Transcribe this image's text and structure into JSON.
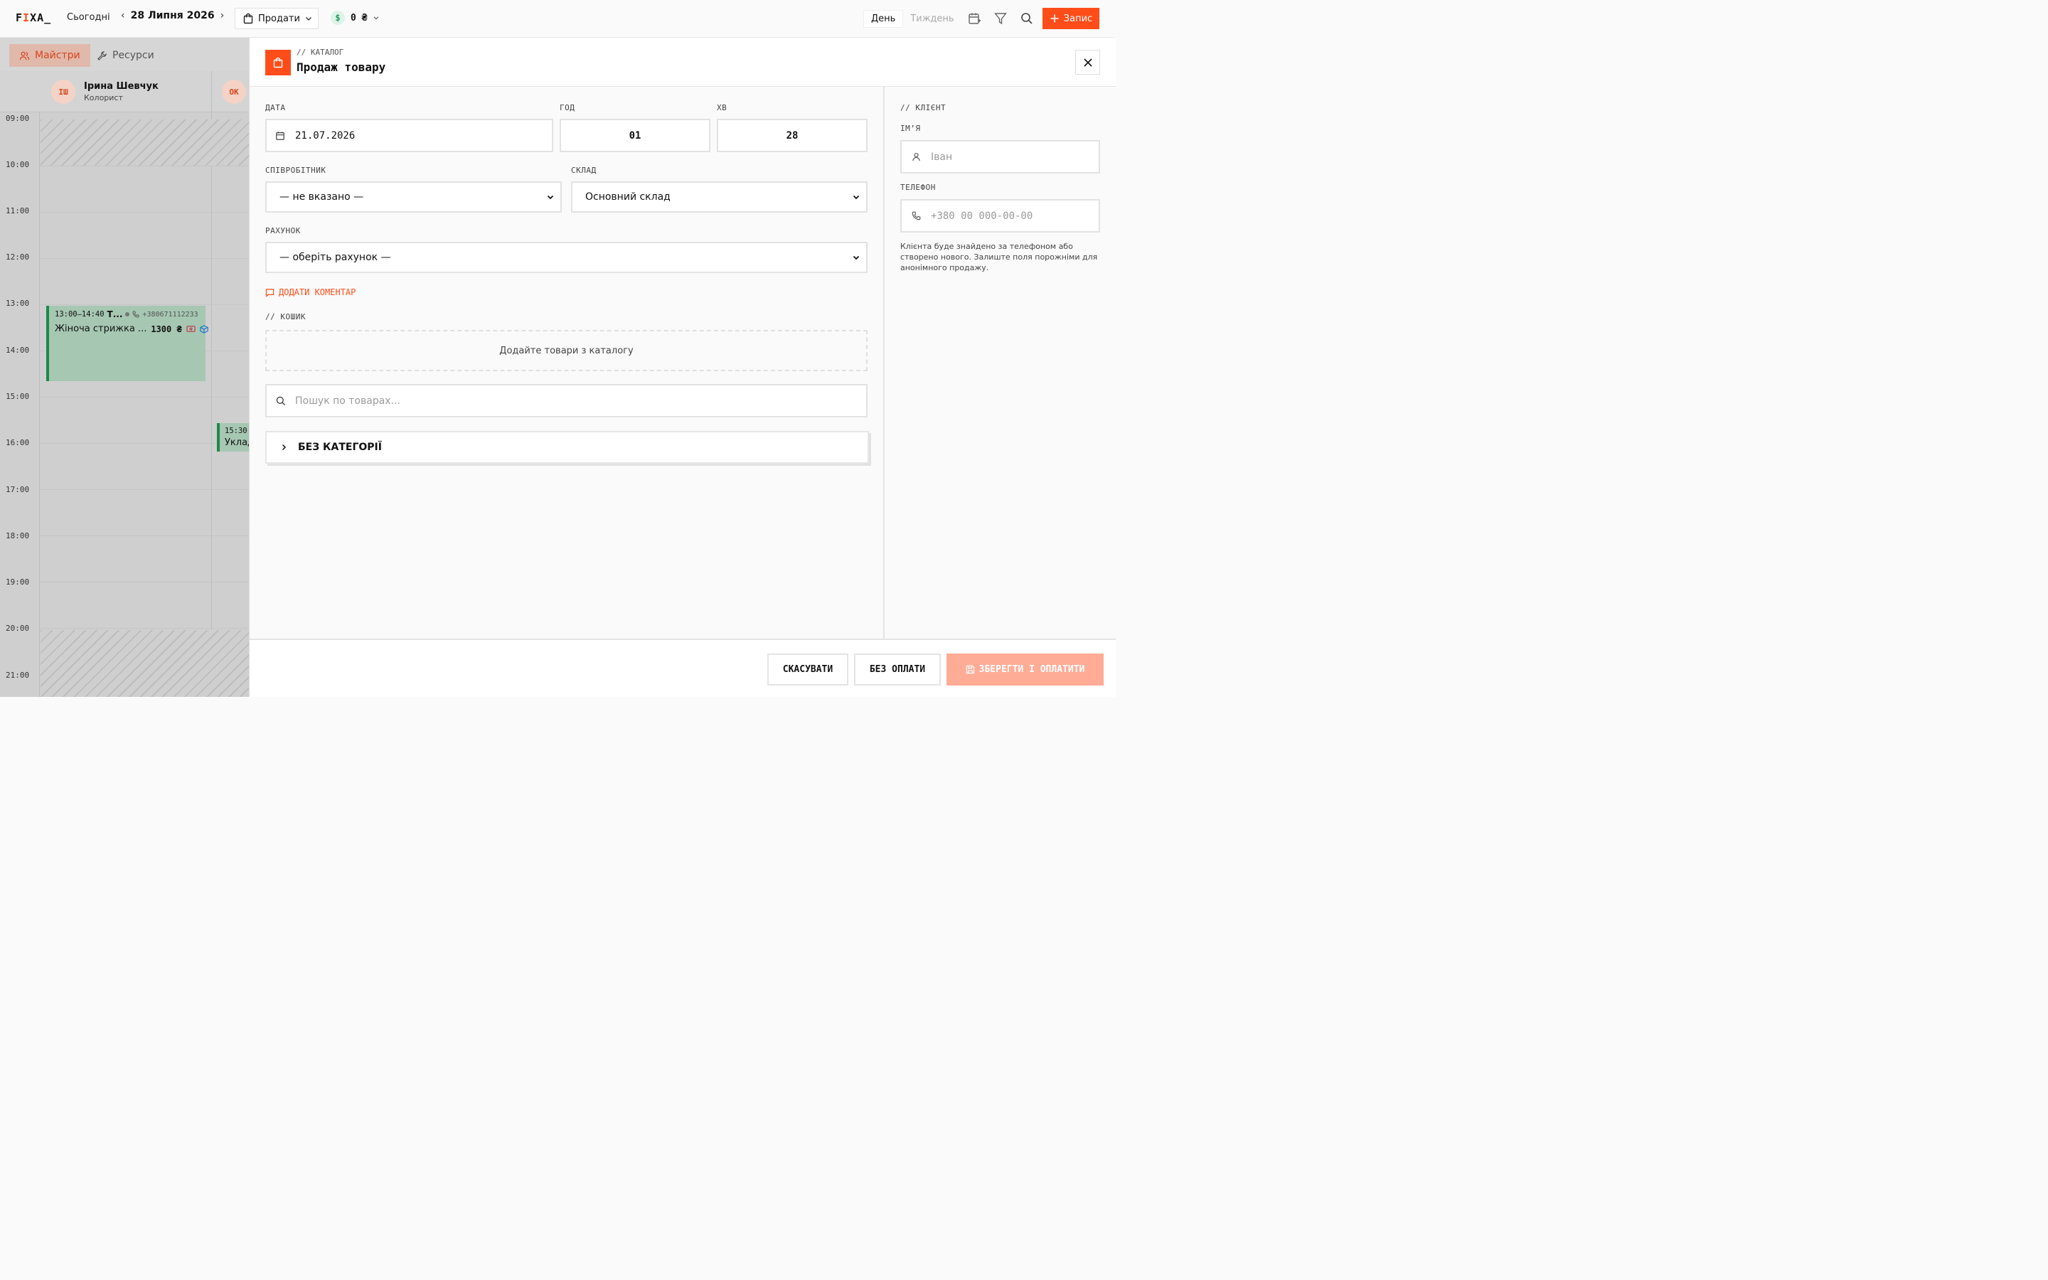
{
  "topbar": {
    "logo_f": "F",
    "logo_i": "I",
    "logo_rest": "XA_",
    "today_label": "Сьогодні",
    "date": "28 Липня 2026",
    "sell_label": "Продати",
    "cash_amount": "0 ₴",
    "view_day": "День",
    "view_week": "Тиждень",
    "add_label": "Запис",
    "accent_color": "#ff4d1a"
  },
  "calendar": {
    "tab_masters": "Майстри",
    "tab_resources": "Ресурси",
    "staff": [
      {
        "initials": "ІШ",
        "name": "Ірина Шевчук",
        "role": "Колорист"
      },
      {
        "initials": "ОК",
        "name": "",
        "role": ""
      }
    ],
    "times": [
      "09:00",
      "10:00",
      "11:00",
      "12:00",
      "13:00",
      "14:00",
      "15:00",
      "16:00",
      "17:00",
      "18:00",
      "19:00",
      "20:00",
      "21:00"
    ],
    "appointments": [
      {
        "time": "13:00–14:40",
        "client": "Т...",
        "phone": "+380671112233",
        "service": "Жіноча стрижка ...",
        "price": "1300 ₴"
      },
      {
        "time": "15:30",
        "service": "Уклад"
      }
    ]
  },
  "modal": {
    "kicker": "// КАТАЛОГ",
    "title": "Продаж товару",
    "date_label": "ДАТА",
    "date_value": "21.07.2026",
    "hour_label": "ГОД",
    "hour_value": "01",
    "min_label": "ХВ",
    "min_value": "28",
    "employee_label": "СПІВРОБІТНИК",
    "employee_value": "— не вказано —",
    "warehouse_label": "СКЛАД",
    "warehouse_value": "Основний склад",
    "account_label": "РАХУНОК",
    "account_value": "— оберіть рахунок —",
    "add_comment": "ДОДАТИ КОМЕНТАР",
    "cart_label": "// КОШИК",
    "cart_empty": "Додайте товари з каталогу",
    "search_placeholder": "Пошук по товарах...",
    "category": "БЕЗ КАТЕГОРІЇ",
    "client_label": "// КЛІЄНТ",
    "name_label": "ІМ’Я",
    "name_placeholder": "Іван",
    "phone_label": "ТЕЛЕФОН",
    "phone_placeholder": "+380 00 000-00-00",
    "client_note": "Клієнта буде знайдено за телефоном або створено нового. Залиште поля порожніми для анонімного продажу.",
    "cancel": "СКАСУВАТИ",
    "no_payment": "БЕЗ ОПЛАТИ",
    "save_pay": "ЗБЕРЕГТИ І ОПЛАТИТИ"
  }
}
